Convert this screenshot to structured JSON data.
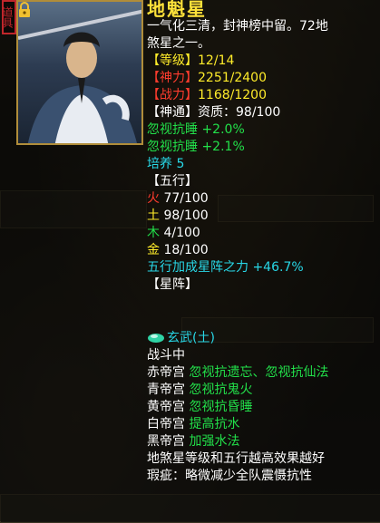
{
  "stamp_text": "道具",
  "title": "地魁星",
  "desc": [
    "一气化三清，封神榜中留。72地",
    "煞星之一。"
  ],
  "stats": [
    {
      "label": "【等级】",
      "value": "12/14"
    },
    {
      "label": "【神力】",
      "value": "2251/2400"
    },
    {
      "label": "【战力】",
      "value": "1168/1200"
    },
    {
      "label": "【神通】",
      "value": "资质：98/100"
    }
  ],
  "bonuses": [
    "忽视抗睡 +2.0%",
    "忽视抗睡 +2.1%"
  ],
  "cultivate": "培养 5",
  "wuxing_header": "【五行】",
  "wuxing": [
    {
      "label": "火",
      "value": "77/100"
    },
    {
      "label": "土",
      "value": "98/100"
    },
    {
      "label": "木",
      "value": "4/100"
    },
    {
      "label": "金",
      "value": "18/100"
    }
  ],
  "wuxing_bonus": "五行加成星阵之力 +46.7%",
  "xingzhen_header": "【星阵】",
  "formation": "玄武(土)",
  "status": "战斗中",
  "palaces": [
    {
      "name": "赤帝宫",
      "effect": "忽视抗遗忘、忽视抗仙法"
    },
    {
      "name": "青帝宫",
      "effect": "忽视抗鬼火"
    },
    {
      "name": "黄帝宫",
      "effect": "忽视抗昏睡"
    },
    {
      "name": "白帝宫",
      "effect": "提高抗水"
    },
    {
      "name": "黑帝宫",
      "effect": "加强水法"
    }
  ],
  "note": "地煞星等级和五行越高效果越好",
  "flaw": "瑕疵：略微减少全队震慑抗性",
  "icons": {
    "lock": "lock-icon",
    "gem": "gem-icon"
  },
  "colors": {
    "title": "#ffe23a",
    "green": "#22e04a",
    "cyan": "#28d7e6",
    "red": "#ff3c2e",
    "frame": "#b08d3a"
  }
}
